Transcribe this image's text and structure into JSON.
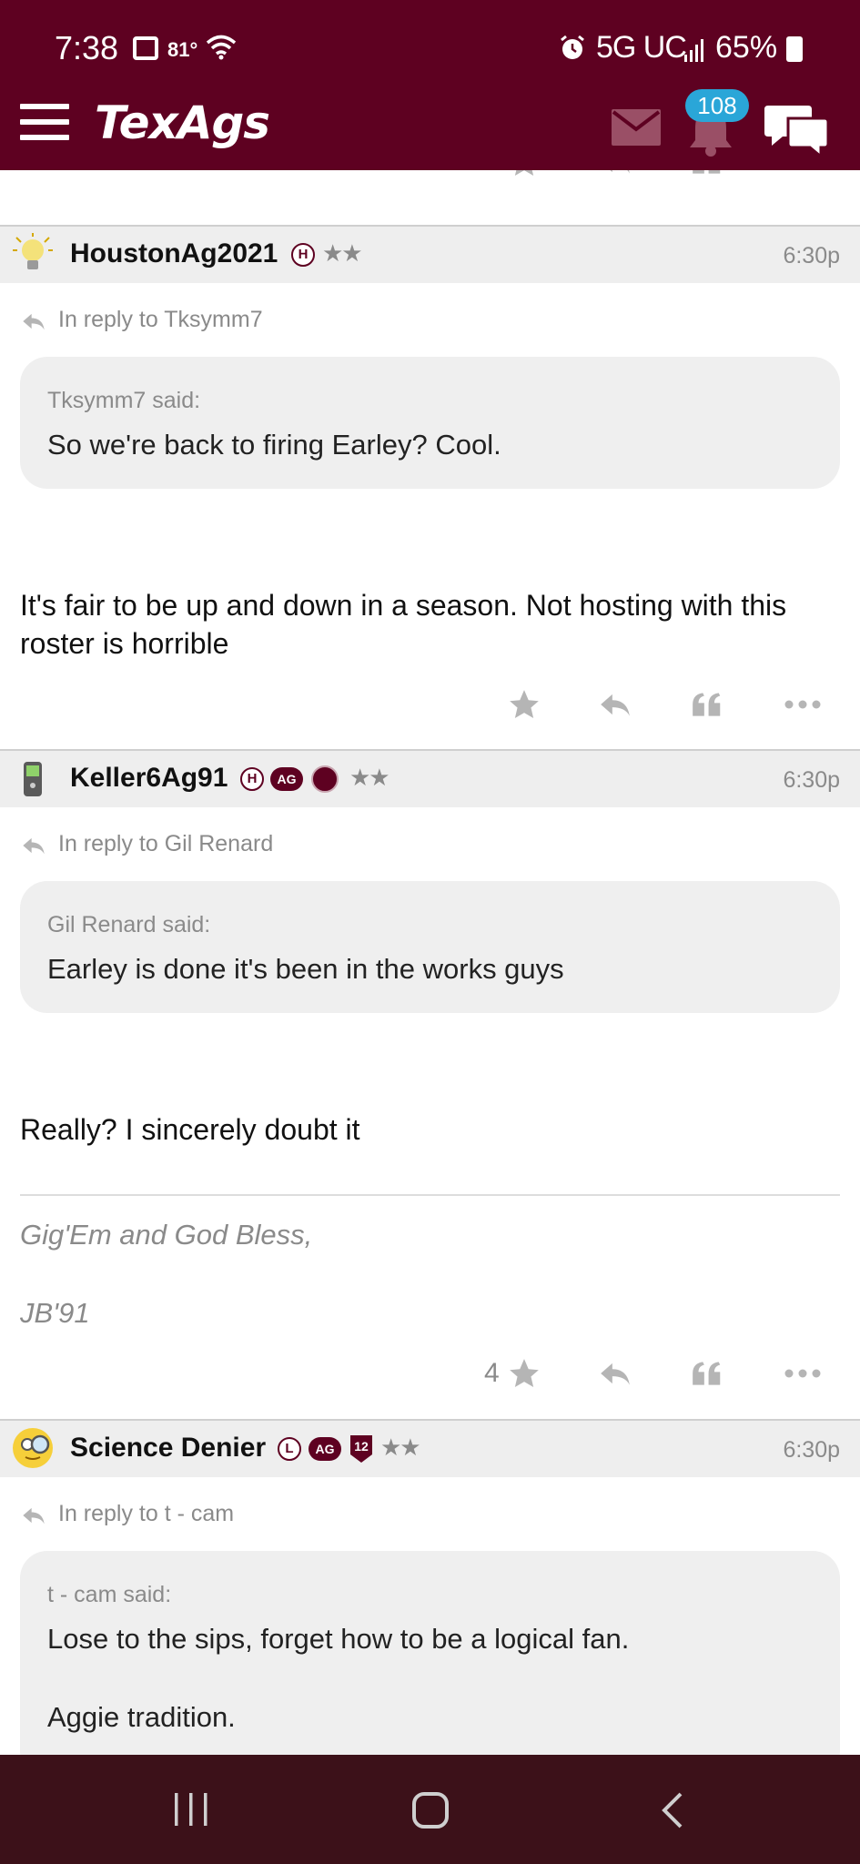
{
  "status_bar": {
    "time": "7:38",
    "temperature": "81°",
    "network": "5G UC",
    "battery": "65%"
  },
  "header": {
    "logo_text": "TexAgs",
    "notification_count": "108"
  },
  "posts": [
    {
      "username": "HoustonAg2021",
      "badges": [
        "H"
      ],
      "stars": "★★",
      "time": "6:30p",
      "reply_to": "In reply to Tksymm7",
      "quote_author": "Tksymm7 said:",
      "quote_text": "So we're back to firing Earley? Cool.",
      "body": "It's fair to be up and down in a season. Not hosting with this roster is horrible"
    },
    {
      "username": "Keller6Ag91",
      "badges": [
        "H",
        "AG"
      ],
      "stars": "★★",
      "time": "6:30p",
      "reply_to": "In reply to Gil Renard",
      "quote_author": "Gil Renard said:",
      "quote_text": "Earley is done it's been in the works guys",
      "body": "Really? I sincerely doubt it",
      "signature_line1": "Gig'Em and God Bless,",
      "signature_line2": "JB'91",
      "star_count": "4"
    },
    {
      "username": "Science Denier",
      "badges": [
        "L",
        "AG",
        "12"
      ],
      "stars": "★★",
      "time": "6:30p",
      "reply_to": "In reply to t - cam",
      "quote_author": "t - cam said:",
      "quote_text_line1": "Lose to the sips, forget how to be a logical fan.",
      "quote_text_line2": "Aggie tradition."
    }
  ],
  "colors": {
    "maroon": "#5e0121",
    "badge_blue": "#2aa6d8",
    "nav_dark": "#3c1119",
    "muted_gray": "#8a8a8a"
  }
}
